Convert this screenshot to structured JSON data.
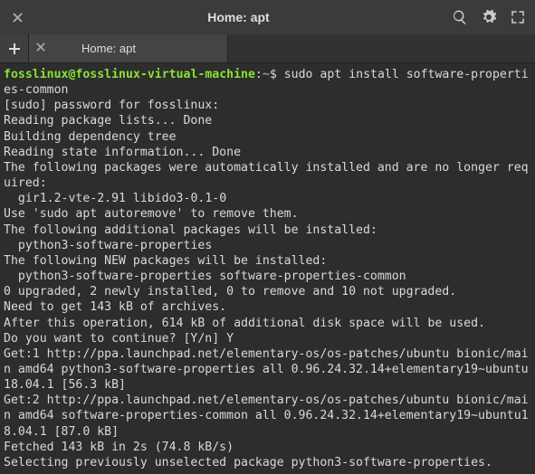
{
  "titlebar": {
    "title": "Home: apt"
  },
  "tab": {
    "label": "Home: apt"
  },
  "prompt": {
    "user": "fosslinux",
    "at": "@",
    "host": "fosslinux-virtual-machine",
    "colon": ":",
    "path": "~",
    "symbol": "$",
    "command": "sudo apt install software-properties-common"
  },
  "output": {
    "l1": "[sudo] password for fosslinux:",
    "l2": "Reading package lists... Done",
    "l3": "Building dependency tree",
    "l4": "Reading state information... Done",
    "l5": "The following packages were automatically installed and are no longer required:",
    "l6": "  gir1.2-vte-2.91 libido3-0.1-0",
    "l7": "Use 'sudo apt autoremove' to remove them.",
    "l8": "The following additional packages will be installed:",
    "l9": "  python3-software-properties",
    "l10": "The following NEW packages will be installed:",
    "l11": "  python3-software-properties software-properties-common",
    "l12": "0 upgraded, 2 newly installed, 0 to remove and 10 not upgraded.",
    "l13": "Need to get 143 kB of archives.",
    "l14": "After this operation, 614 kB of additional disk space will be used.",
    "l15": "Do you want to continue? [Y/n] Y",
    "l16": "Get:1 http://ppa.launchpad.net/elementary-os/os-patches/ubuntu bionic/main amd64 python3-software-properties all 0.96.24.32.14+elementary19~ubuntu18.04.1 [56.3 kB]",
    "l17": "Get:2 http://ppa.launchpad.net/elementary-os/os-patches/ubuntu bionic/main amd64 software-properties-common all 0.96.24.32.14+elementary19~ubuntu18.04.1 [87.0 kB]",
    "l18": "Fetched 143 kB in 2s (74.8 kB/s)",
    "l19": "Selecting previously unselected package python3-software-properties."
  }
}
